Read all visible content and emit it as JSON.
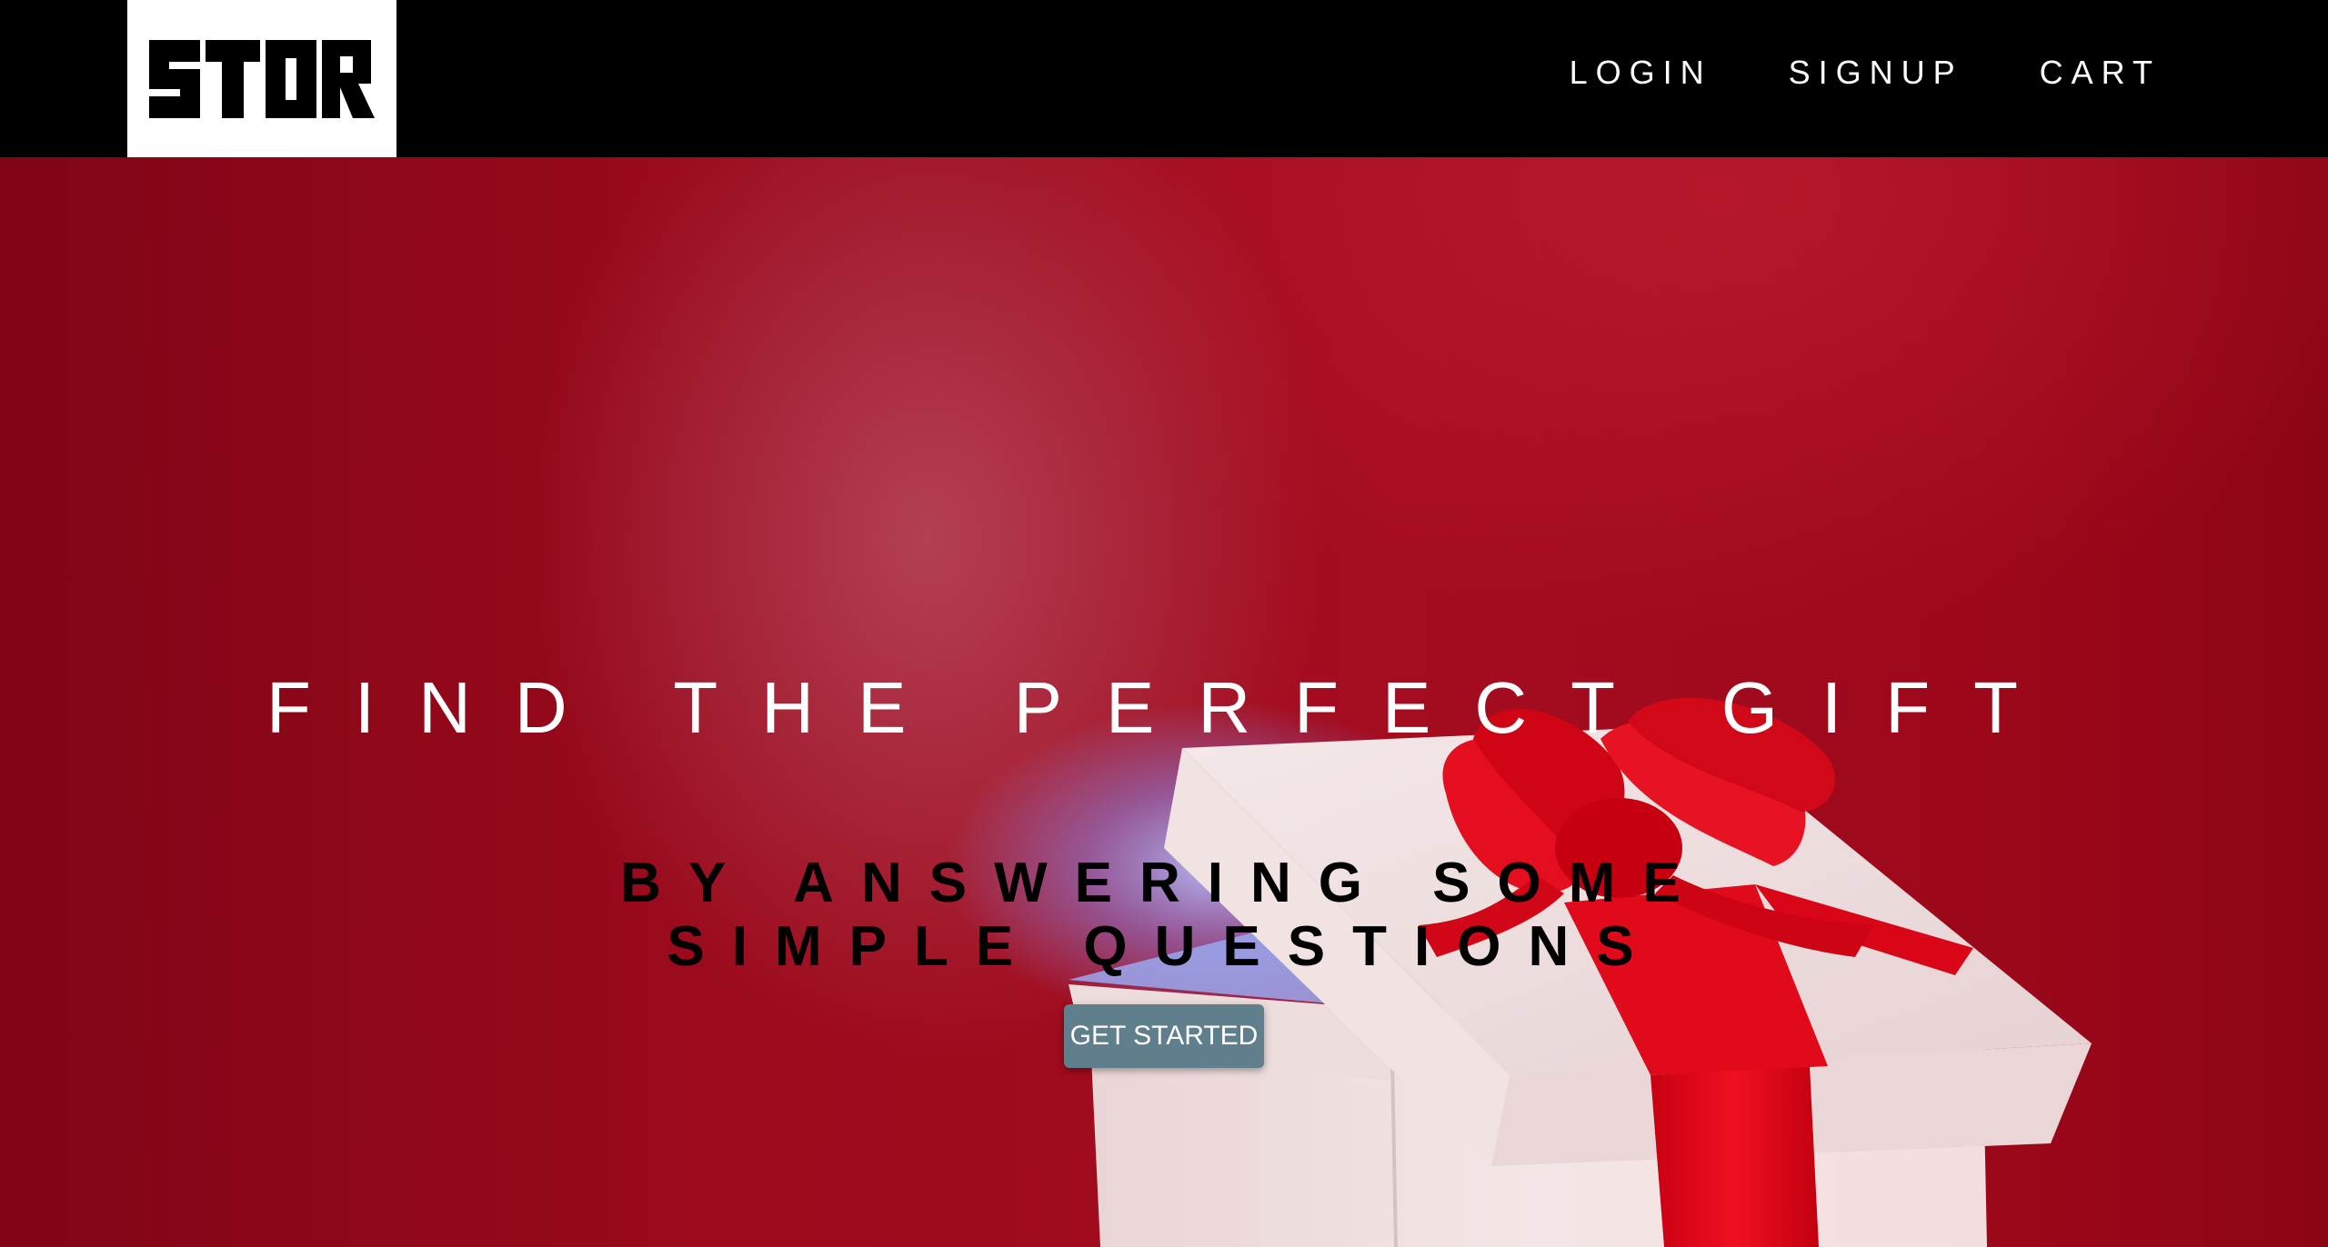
{
  "brand": {
    "logo_text": "STOR",
    "logo_bg_color": "#ffffff",
    "logo_fg_color": "#000000"
  },
  "nav": {
    "links": [
      {
        "label": "LOGIN"
      },
      {
        "label": "SIGNUP"
      },
      {
        "label": "CART"
      }
    ],
    "bg_color": "#000000"
  },
  "hero": {
    "headline": "FIND THE PERFECT GIFT",
    "subheadline_line1": "BY ANSWERING SOME",
    "subheadline_line2": "SIMPLE QUESTIONS",
    "cta_label": "GET STARTED",
    "cta_color": "#5f7f8c",
    "background_image": "red-background-open-white-gift-box-red-ribbon-glowing-light"
  }
}
